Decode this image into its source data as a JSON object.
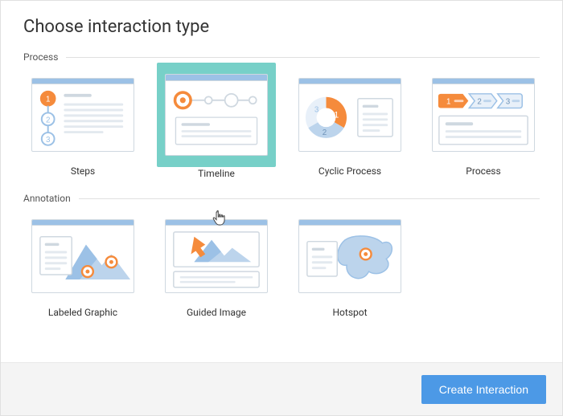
{
  "dialog": {
    "title": "Choose interaction type"
  },
  "sections": {
    "process": {
      "label": "Process"
    },
    "annotation": {
      "label": "Annotation"
    }
  },
  "options": {
    "steps": {
      "label": "Steps"
    },
    "timeline": {
      "label": "Timeline"
    },
    "cyclic": {
      "label": "Cyclic Process"
    },
    "process": {
      "label": "Process"
    },
    "labeled_graphic": {
      "label": "Labeled Graphic"
    },
    "guided_image": {
      "label": "Guided Image"
    },
    "hotspot": {
      "label": "Hotspot"
    }
  },
  "footer": {
    "create_label": "Create Interaction"
  },
  "colors": {
    "accent_orange": "#f58b3c",
    "accent_blue": "#9cc1e6",
    "accent_blue_dark": "#4c99e6",
    "selected_bg": "#77d0c8",
    "line_gray": "#cfd8e0"
  }
}
